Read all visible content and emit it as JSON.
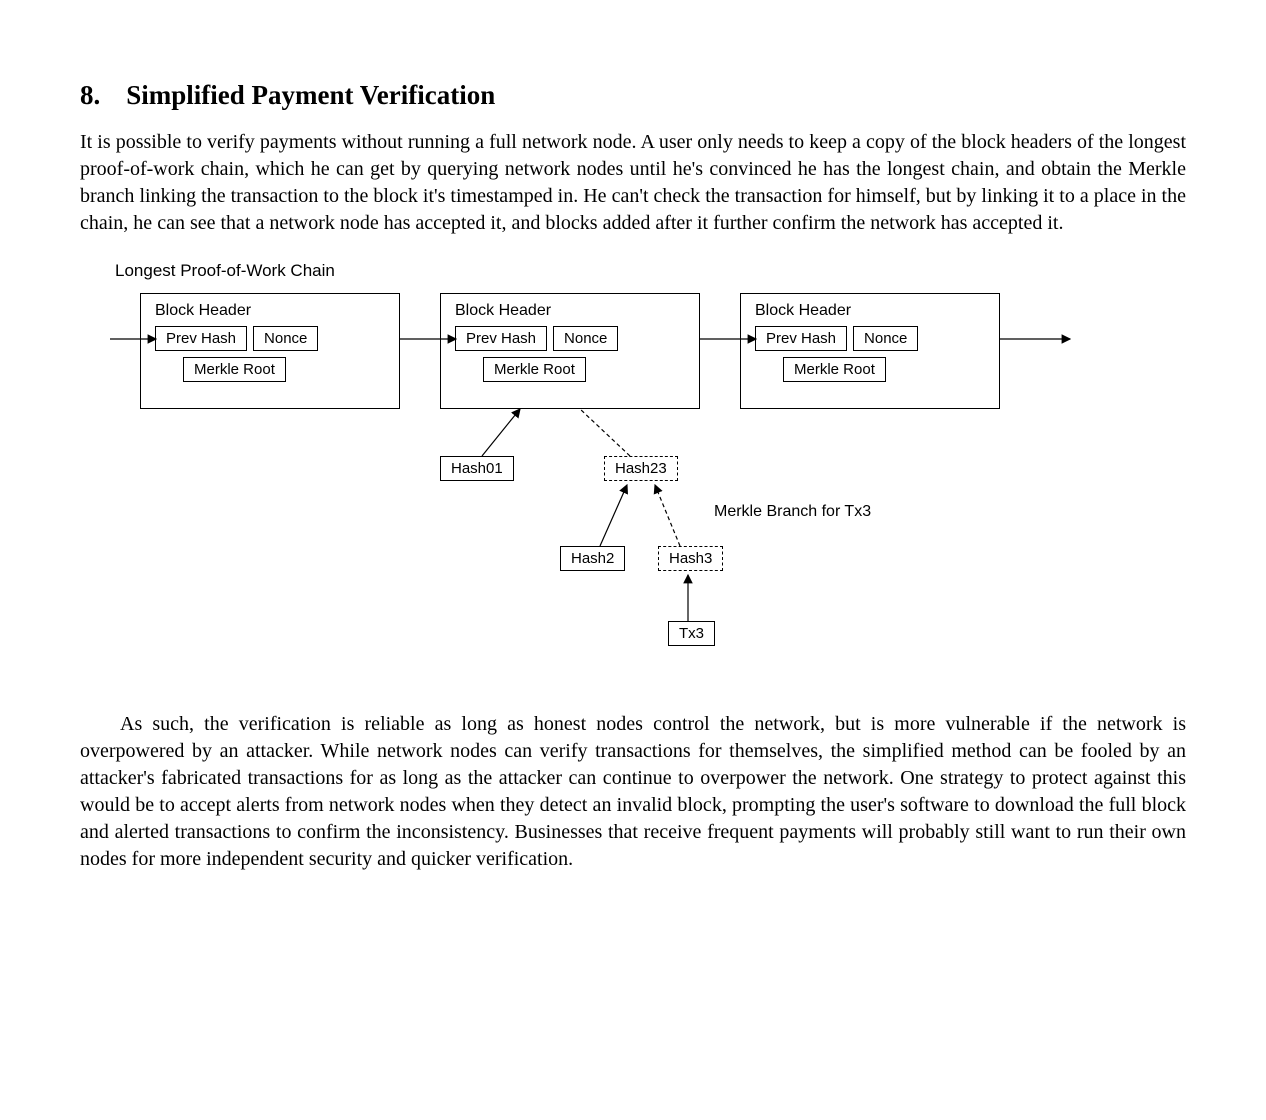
{
  "section": {
    "number": "8.",
    "title": "Simplified Payment Verification"
  },
  "paragraphs": {
    "p1": "It is possible to verify payments without running a full network node.  A user only needs to keep a copy of the block headers of the longest proof-of-work chain, which he can get by querying network nodes until he's convinced he has the longest chain, and obtain the Merkle branch linking the transaction to the block it's timestamped in.  He can't check the transaction for himself, but by linking it to a place in the chain, he can see that a network node has accepted it, and blocks added after it further confirm the network has accepted it.",
    "p2": "As such, the verification is reliable as long as honest nodes control the network, but is more vulnerable if the network is overpowered by an attacker.  While network nodes can verify transactions for themselves, the simplified method can be fooled by an attacker's fabricated transactions for as long as the attacker can continue to overpower the network.  One strategy to protect against this would be to accept alerts from network nodes when they detect an invalid block, prompting the user's software to download the full block and alerted transactions to confirm the inconsistency.  Businesses that receive frequent payments will probably still want to run their own nodes for more independent security and quicker verification."
  },
  "diagram": {
    "chain_label": "Longest Proof-of-Work Chain",
    "branch_label": "Merkle Branch for Tx3",
    "block_header": "Block Header",
    "prev_hash": "Prev Hash",
    "nonce": "Nonce",
    "merkle_root": "Merkle Root",
    "hash01": "Hash01",
    "hash23": "Hash23",
    "hash2": "Hash2",
    "hash3": "Hash3",
    "tx3": "Tx3"
  }
}
